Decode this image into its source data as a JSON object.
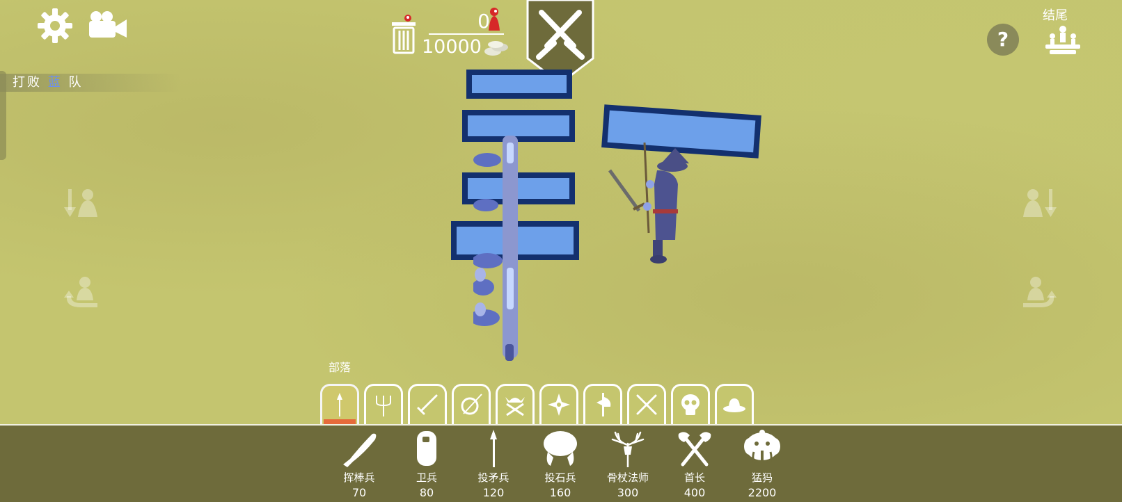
{
  "top_bar": {
    "unit_count": "0",
    "budget": "10000",
    "end_label": "结尾",
    "help_label": "?"
  },
  "objective": {
    "prefix": "打败",
    "team": "蓝",
    "suffix": "队"
  },
  "faction_bar": {
    "label": "部落",
    "tabs": [
      {
        "name": "tribal-spear-icon"
      },
      {
        "name": "trident-icon"
      },
      {
        "name": "sword-icon"
      },
      {
        "name": "shield-spear-icon"
      },
      {
        "name": "viking-helmet-axes-icon"
      },
      {
        "name": "shuriken-icon"
      },
      {
        "name": "halberd-icon"
      },
      {
        "name": "crossed-swords-icon"
      },
      {
        "name": "skull-icon"
      },
      {
        "name": "cowboy-hat-icon"
      }
    ]
  },
  "units": [
    {
      "name": "挥棒兵",
      "cost": "70",
      "icon": "club-icon"
    },
    {
      "name": "卫兵",
      "cost": "80",
      "icon": "protector-shield-icon"
    },
    {
      "name": "投矛兵",
      "cost": "120",
      "icon": "spear-icon"
    },
    {
      "name": "投石兵",
      "cost": "160",
      "icon": "stone-thrower-icon"
    },
    {
      "name": "骨杖法师",
      "cost": "300",
      "icon": "antler-staff-icon"
    },
    {
      "name": "首长",
      "cost": "400",
      "icon": "double-axe-icon"
    },
    {
      "name": "猛犸",
      "cost": "2200",
      "icon": "mammoth-icon"
    }
  ],
  "colors": {
    "grass": "#c4c56f",
    "tray": "#6e6b3b",
    "hp_fill": "#6da0ea",
    "hp_border": "#13306e",
    "active_tab_underline": "#e66a3a",
    "objective_team": "#6b8ff0",
    "red_pawn": "#d62828"
  }
}
